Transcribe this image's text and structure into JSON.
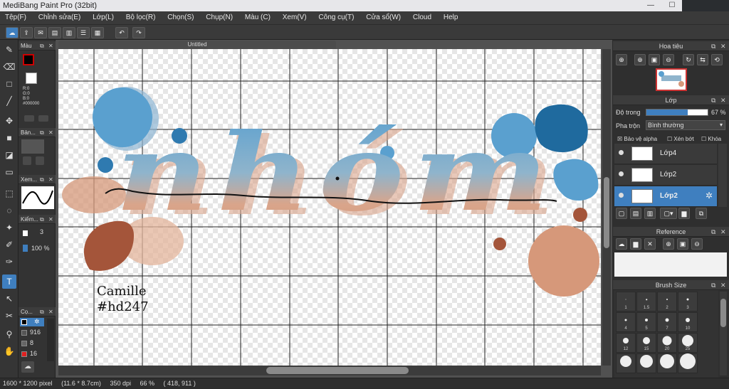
{
  "app": {
    "title": "MediBang Paint Pro (32bit)",
    "window_controls": {
      "minimize": "—",
      "maximize": "☐"
    }
  },
  "menu": [
    "Tệp(F)",
    "Chỉnh sửa(E)",
    "Lớp(L)",
    "Bộ lọc(R)",
    "Chọn(S)",
    "Chụp(N)",
    "Màu (C)",
    "Xem(V)",
    "Công cụ(T)",
    "Cửa sổ(W)",
    "Cloud",
    "Help"
  ],
  "left_panels": {
    "color": {
      "title": "Màu",
      "rgb": [
        "R:0",
        "G:0",
        "B:0",
        "#000000"
      ]
    },
    "brush_panel": {
      "title": "Bản..."
    },
    "curve_panel": {
      "title": "Xem..."
    },
    "check_panel": {
      "title": "Kiểm...",
      "size_value": "3",
      "opacity_value": "100 %"
    },
    "color_list": {
      "title": "Cọ...",
      "items": [
        "916",
        "8",
        "16"
      ]
    }
  },
  "document": {
    "tab_title": "Untitled"
  },
  "canvas_text": {
    "lettering": "nhóm",
    "signature_name": "Camille",
    "signature_tag": "#hd247"
  },
  "right_panels": {
    "navigator": {
      "title": "Hoa tiêu"
    },
    "layer": {
      "title": "Lớp",
      "opacity_label": "Độ trong",
      "opacity_value": "67 %",
      "opacity_fraction": 0.67,
      "blend_label": "Pha trộn",
      "blend_value": "Bình thường",
      "protect_alpha": "Bảo vệ alpha",
      "clip": "Xén bớt",
      "lock": "Khóa",
      "layers": [
        {
          "name": "Lớp4",
          "selected": false
        },
        {
          "name": "Lớp2",
          "selected": false
        },
        {
          "name": "Lớp2",
          "selected": true
        }
      ]
    },
    "reference": {
      "title": "Reference"
    },
    "brush_size": {
      "title": "Brush Size",
      "labels": [
        "1",
        "1.5",
        "2",
        "3",
        "4",
        "5",
        "7",
        "10",
        "12",
        "15",
        "20",
        "25"
      ]
    }
  },
  "status": {
    "pixel_size": "1600 * 1200 pixel",
    "cm_size": "(11.6 * 8.7cm)",
    "dpi": "350 dpi",
    "zoom": "66 %",
    "coords": "( 418, 911 )"
  },
  "colors": {
    "accent": "#3f7fbf",
    "blue_light": "#5aa0cf",
    "blue_dark": "#1f6a9e",
    "peach": "#d6987a",
    "brown": "#a4553a",
    "primary_color": "#000000"
  }
}
